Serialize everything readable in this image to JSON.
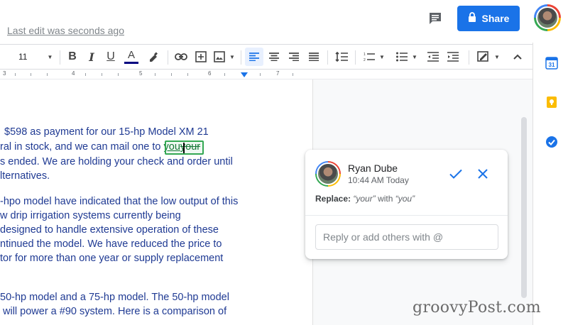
{
  "header": {
    "last_edit": "Last edit was seconds ago",
    "share_label": "Share",
    "share_icon": "lock-icon",
    "comment_icon": "comment-icon",
    "accent": "#1a73e8"
  },
  "toolbar": {
    "font_size": "11",
    "items": [
      "font-size-select",
      "bold",
      "italic",
      "underline",
      "text-color",
      "highlight",
      "link",
      "insert-comment",
      "insert-image",
      "align-left",
      "align-center",
      "align-right",
      "justify",
      "line-spacing",
      "numbered-list",
      "bulleted-list",
      "decrease-indent",
      "increase-indent",
      "editing-mode",
      "collapse"
    ],
    "bold_label": "B",
    "italic_label": "I",
    "underline_label": "U",
    "text_color_label": "A"
  },
  "ruler": {
    "labels": [
      "3",
      "4",
      "5",
      "6",
      "7"
    ]
  },
  "document": {
    "lines": [
      "$598 as payment for our 15-hp Model XM 21",
      "ral in stock, and we can mail one to ",
      "s ended.  We are holding your check and order until",
      "lternatives.",
      "-hpo model have indicated that the low output of this",
      "w drip irrigation systems  currently being",
      "designed to handle extensive operation of these",
      "ntinued the model.  We have reduced the price to",
      "tor for more than one year or supply replacement",
      "50-hp model and a 75-hp model.  The 50-hp model",
      "will power a #90 system.  Here is a comparison of"
    ],
    "suggestion_insert": "you",
    "suggestion_delete": "your"
  },
  "comment": {
    "author": "Ryan Dube",
    "time": "10:44 AM Today",
    "replace_label": "Replace:",
    "replace_from": "“your”",
    "replace_with_word": "with",
    "replace_to": "“you”",
    "reply_placeholder": "Reply or add others with @",
    "accept_color": "#1a73e8"
  },
  "side_panel": {
    "icons": [
      "calendar-icon",
      "keep-icon",
      "tasks-icon"
    ],
    "calendar_day": "31"
  },
  "watermark": "groovyPost.com"
}
